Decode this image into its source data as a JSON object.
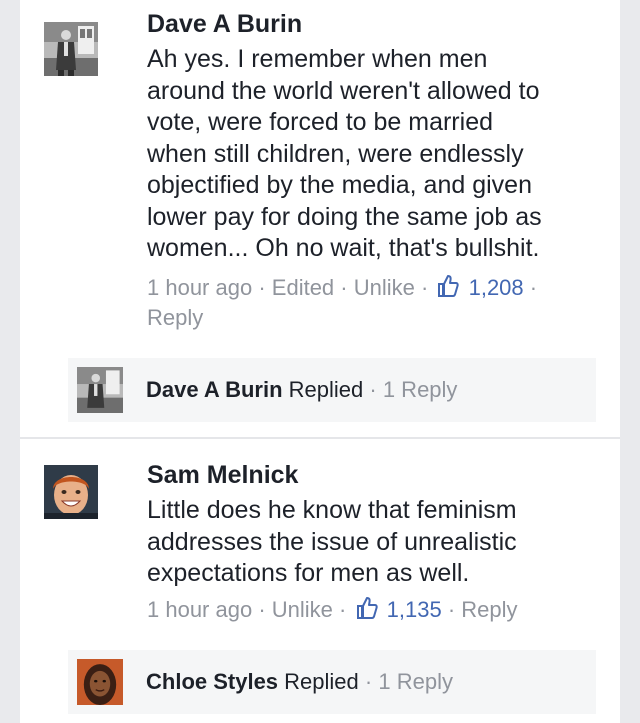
{
  "comments": [
    {
      "name": "Dave A Burin",
      "lines": [
        "Ah yes.  I remember when men",
        "around the world weren't allowed to",
        "vote, were forced to be married",
        "when still children, were endlessly",
        "objectified by the media, and given",
        "lower pay for doing the same job as",
        "women... Oh no wait, that's bullshit."
      ],
      "time": "1 hour ago",
      "edited": "Edited",
      "unlike": "Unlike",
      "likes": "1,208",
      "reply": "Reply",
      "replied_name": "Dave A Burin",
      "replied_label": "Replied",
      "replies": "1 Reply"
    },
    {
      "name": "Sam Melnick",
      "lines": [
        "Little does he know that feminism",
        "addresses the issue of unrealistic",
        "expectations for men as well."
      ],
      "time": "1 hour ago",
      "unlike": "Unlike",
      "likes": "1,135",
      "reply": "Reply",
      "replied_name": "Chloe Styles",
      "replied_label": "Replied",
      "replies": "1 Reply"
    }
  ],
  "separator": "·",
  "colors": {
    "link": "#4267b2",
    "meta": "#90949c",
    "text": "#1d2129"
  },
  "icons": {
    "like": "thumbs-up-icon"
  }
}
